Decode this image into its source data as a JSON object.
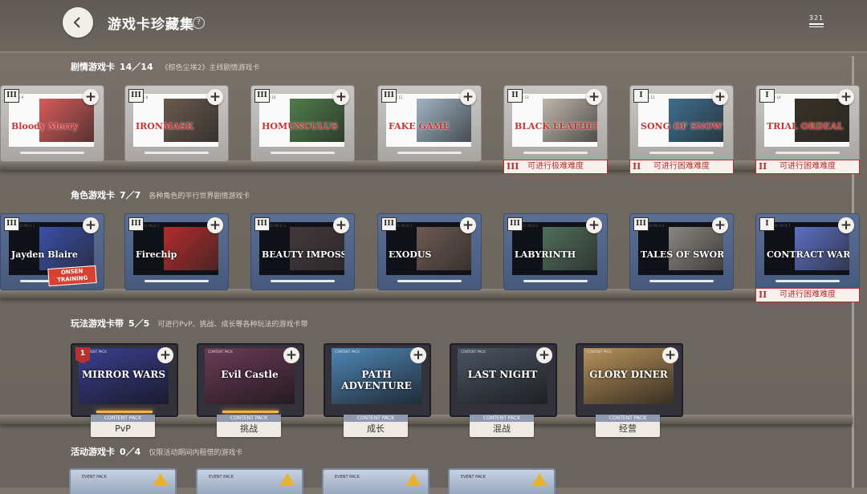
{
  "header": {
    "title": "游戏卡珍藏集",
    "help_icon": "?",
    "menu_count": "321"
  },
  "sections": {
    "story": {
      "title": "剧情游戏卡",
      "count": "14／14",
      "desc": "《棕色尘埃2》主线剧情游戏卡"
    },
    "character": {
      "title": "角色游戏卡",
      "count": "7／7",
      "desc": "各种角色的平行世界剧情游戏卡"
    },
    "play": {
      "title": "玩法游戏卡带",
      "count": "5／5",
      "desc": "可进行PvP、挑战、成长等各种玩法的游戏卡带"
    },
    "event": {
      "title": "活动游戏卡",
      "count": "0／4",
      "desc": "仅限活动期间内租借的游戏卡"
    }
  },
  "story_cards": [
    {
      "tier": "III",
      "pack": "PACK 9",
      "title": "Bloody Merry"
    },
    {
      "tier": "III",
      "pack": "PACK 8",
      "title": "IRONMASK"
    },
    {
      "tier": "III",
      "pack": "PACK 10",
      "title": "HOMUNCULUS"
    },
    {
      "tier": "III",
      "pack": "PACK 11",
      "title": "FAKE GAME"
    },
    {
      "tier": "II",
      "pack": "PACK 13",
      "title": "BLACK FEATHER"
    },
    {
      "tier": "I",
      "pack": "PACK 12",
      "title": "SONG OF SNOW"
    },
    {
      "tier": "I",
      "pack": "PACK 14",
      "title": "TRIAL ORDEAL"
    }
  ],
  "story_diffs": [
    {
      "mark": "III",
      "label": "可进行极难难度"
    },
    {
      "mark": "II",
      "label": "可进行困难难度"
    },
    {
      "mark": "II",
      "label": "可进行困难难度"
    }
  ],
  "character_cards": [
    {
      "tier": "III",
      "pack": "ACTER PACK 1",
      "title": "Jayden Blaire"
    },
    {
      "tier": "III",
      "pack": "ACTER PACK 2",
      "title": "Firechip"
    },
    {
      "tier": "III",
      "pack": "ACTER PACK 3",
      "title": "BEAUTY IMPOSSIBLE"
    },
    {
      "tier": "III",
      "pack": "ACTER PACK 4",
      "title": "EXODUS"
    },
    {
      "tier": "III",
      "pack": "ACTER PACK 5",
      "title": "LABYRINTH"
    },
    {
      "tier": "III",
      "pack": "ACTER PACK 6",
      "title": "TALES OF SWORD"
    },
    {
      "tier": "I",
      "pack": "ACTER PACK 7",
      "title": "CONTRACT WARS"
    }
  ],
  "character_extra": {
    "onsen": "ONSEN TRAINING"
  },
  "character_diff": {
    "mark": "II",
    "label": "可进行困难难度"
  },
  "play_cards": [
    {
      "pack": "CONTENT PACK",
      "title": "MIRROR WARS",
      "mode": "PvP",
      "badge": "1"
    },
    {
      "pack": "CONTENT PACK",
      "title": "Evil Castle",
      "mode": "挑战"
    },
    {
      "pack": "CONTENT PACK",
      "title": "PATH ADVENTURE",
      "mode": "成长"
    },
    {
      "pack": "CONTENT PACK",
      "title": "LAST NIGHT",
      "mode": "混战"
    },
    {
      "pack": "CONTENT PACK",
      "title": "GLORY DINER",
      "mode": "经营"
    }
  ],
  "mode_caption": "CONTENT PACK",
  "event_cards": [
    {
      "pack": "EVENT PACK"
    },
    {
      "pack": "EVENT PACK"
    },
    {
      "pack": "EVENT PACK"
    },
    {
      "pack": "EVENT PACK"
    }
  ],
  "plus_symbol": "+",
  "colors": {
    "accent_red": "#b52f2f",
    "gold": "#ffb23e"
  }
}
